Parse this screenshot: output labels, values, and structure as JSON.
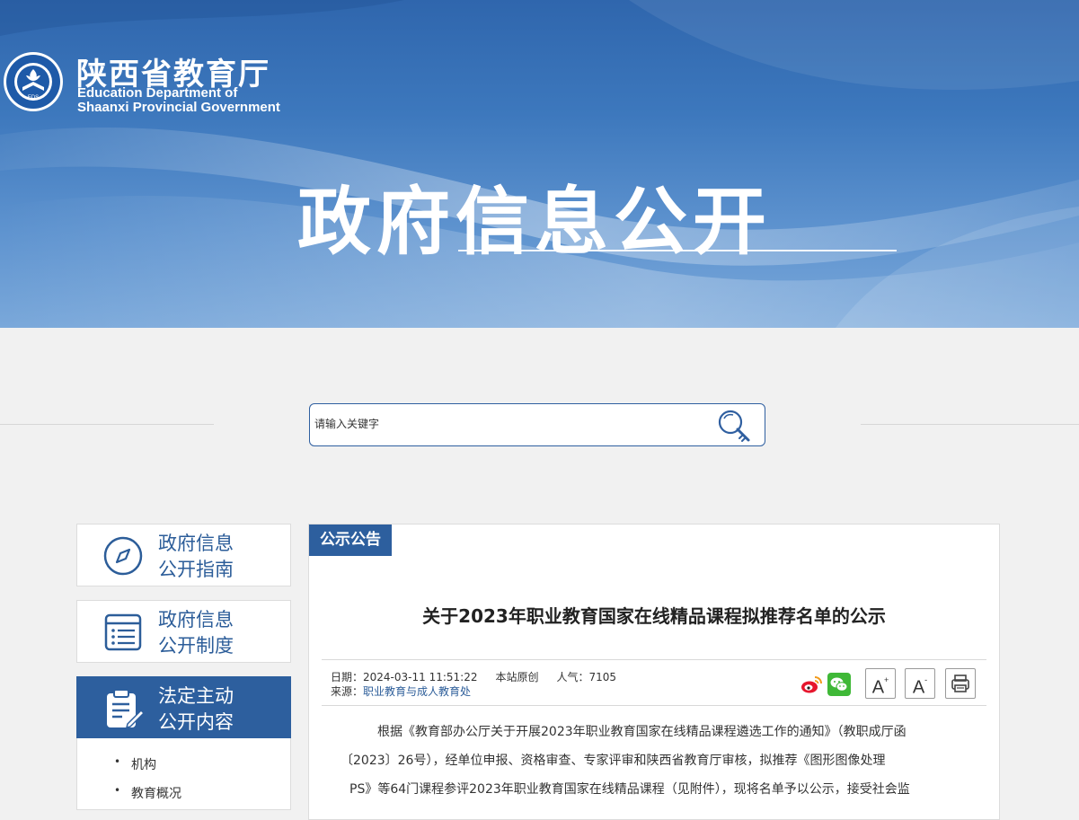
{
  "header": {
    "org_name_cn": "陕西省教育厅",
    "org_name_en_line1": "Education Department of",
    "org_name_en_line2": "Shaanxi Provincial Government",
    "emblem_text": "EDS",
    "banner_title": "政府信息公开"
  },
  "search": {
    "placeholder": "请输入关键字",
    "button_icon": "search-key-icon"
  },
  "sidebar": {
    "items": [
      {
        "line1": "政府信息",
        "line2": "公开指南",
        "icon": "compass-icon",
        "active": false
      },
      {
        "line1": "政府信息",
        "line2": "公开制度",
        "icon": "document-list-icon",
        "active": false
      },
      {
        "line1": "法定主动",
        "line2": "公开内容",
        "icon": "clipboard-edit-icon",
        "active": true
      }
    ],
    "sub_items": [
      "机构",
      "教育概况"
    ]
  },
  "article": {
    "category_tab": "公示公告",
    "title": "关于2023年职业教育国家在线精品课程拟推荐名单的公示",
    "date_label": "日期：",
    "date": "2024-03-11 11:51:22",
    "origin": "本站原创",
    "views_label": "人气：",
    "views": "7105",
    "source_label": "来源：",
    "source": "职业教育与成人教育处",
    "body_lines": [
      "根据《教育部办公厅关于开展2023年职业教育国家在线精品课程遴选工作的通知》（教职成厅函",
      "〔2023〕26号），经单位申报、资格审查、专家评审和陕西省教育厅审核，拟推荐《图形图像处理",
      "PS》等64门课程参评2023年职业教育国家在线精品课程（见附件），现将名单予以公示，接受社会监"
    ]
  },
  "tools": {
    "share": [
      "weibo-icon",
      "wechat-icon"
    ],
    "font_increase": "A",
    "font_increase_sup": "+",
    "font_decrease": "A",
    "font_decrease_sup": "-",
    "print": "printer-icon"
  },
  "colors": {
    "brand_blue": "#2d5f9e",
    "link_blue": "#2c5d99",
    "page_bg": "#f1f1f1"
  }
}
